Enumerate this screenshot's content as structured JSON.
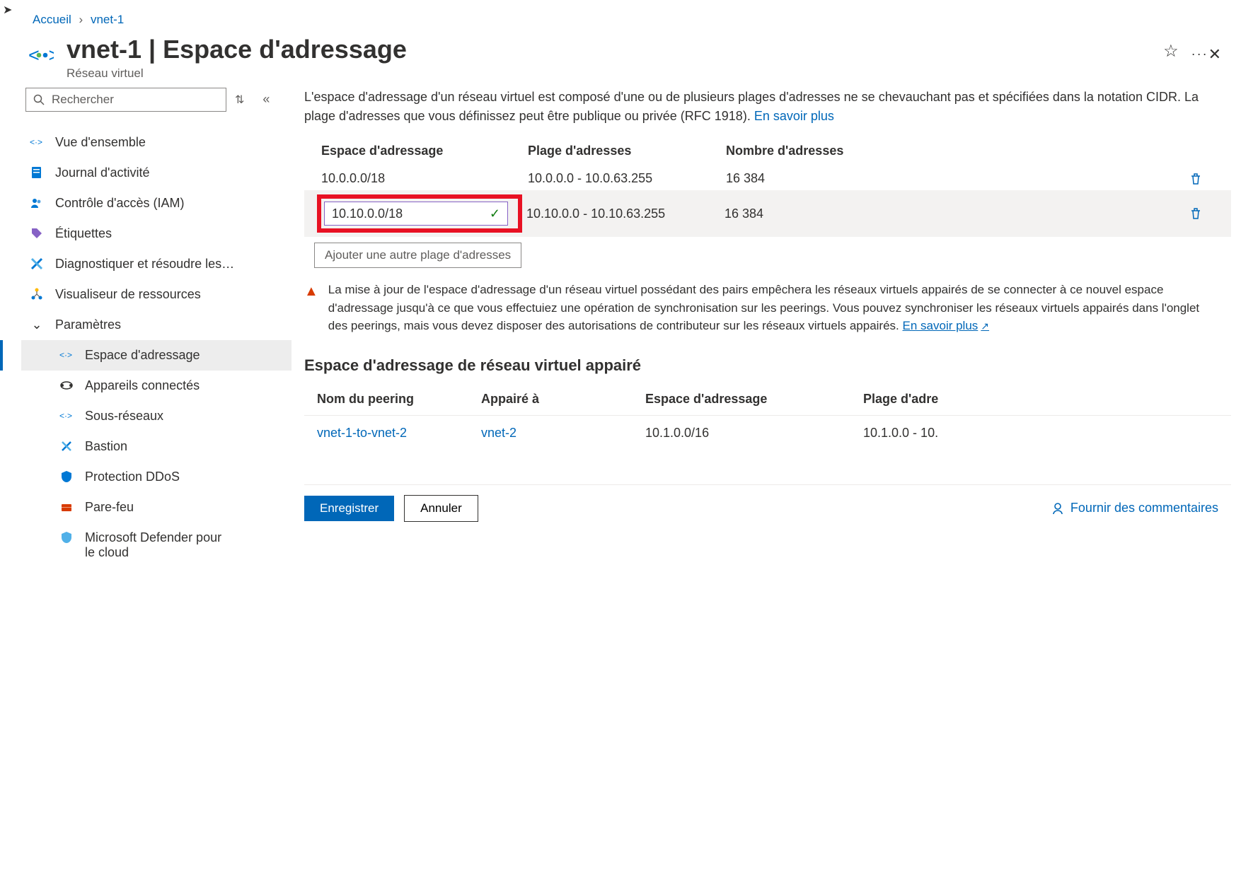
{
  "breadcrumb": {
    "home": "Accueil",
    "current": "vnet-1"
  },
  "header": {
    "title": "vnet-1 | Espace d'adressage",
    "subtitle": "Réseau virtuel"
  },
  "sidebar": {
    "search_placeholder": "Rechercher",
    "overview": "Vue d'ensemble",
    "activity": "Journal d'activité",
    "iam": "Contrôle d'accès (IAM)",
    "tags": "Étiquettes",
    "diagnose": "Diagnostiquer et résoudre les…",
    "visualizer": "Visualiseur de ressources",
    "settings_group": "Paramètres",
    "address_space": "Espace d'adressage",
    "connected_devices": "Appareils connectés",
    "subnets": "Sous-réseaux",
    "bastion": "Bastion",
    "ddos": "Protection DDoS",
    "firewall": "Pare-feu",
    "defender": "Microsoft Defender pour le cloud"
  },
  "main": {
    "intro": "L'espace d'adressage d'un réseau virtuel est composé d'une ou de plusieurs plages d'adresses ne se chevauchant pas et spécifiées dans la notation CIDR. La plage d'adresses que vous définissez peut être publique ou privée (RFC 1918).",
    "intro_link": "En savoir plus",
    "table": {
      "col_space": "Espace d'adressage",
      "col_range": "Plage d'adresses",
      "col_count": "Nombre d'adresses",
      "rows": [
        {
          "space": "10.0.0.0/18",
          "range": "10.0.0.0 - 10.0.63.255",
          "count": "16 384"
        },
        {
          "space": "10.10.0.0/18",
          "range": "10.10.0.0 - 10.10.63.255",
          "count": "16 384"
        }
      ]
    },
    "add_range": "Ajouter une autre plage d'adresses",
    "warning": "La mise à jour de l'espace d'adressage d'un réseau virtuel possédant des pairs empêchera les réseaux virtuels appairés de se connecter à ce nouvel espace d'adressage jusqu'à ce que vous effectuiez une opération de synchronisation sur les peerings. Vous pouvez synchroniser les réseaux virtuels appairés dans l'onglet des peerings, mais vous devez disposer des autorisations de contributeur sur les réseaux virtuels appairés.",
    "warning_link": "En savoir plus",
    "peered_title": "Espace d'adressage de réseau virtuel appairé",
    "peered_table": {
      "col_name": "Nom du peering",
      "col_peered": "Appairé à",
      "col_space": "Espace d'adressage",
      "col_range": "Plage d'adre",
      "row": {
        "name": "vnet-1-to-vnet-2",
        "peered": "vnet-2",
        "space": "10.1.0.0/16",
        "range": "10.1.0.0 - 10."
      }
    }
  },
  "footer": {
    "save": "Enregistrer",
    "cancel": "Annuler",
    "feedback": "Fournir des commentaires"
  }
}
